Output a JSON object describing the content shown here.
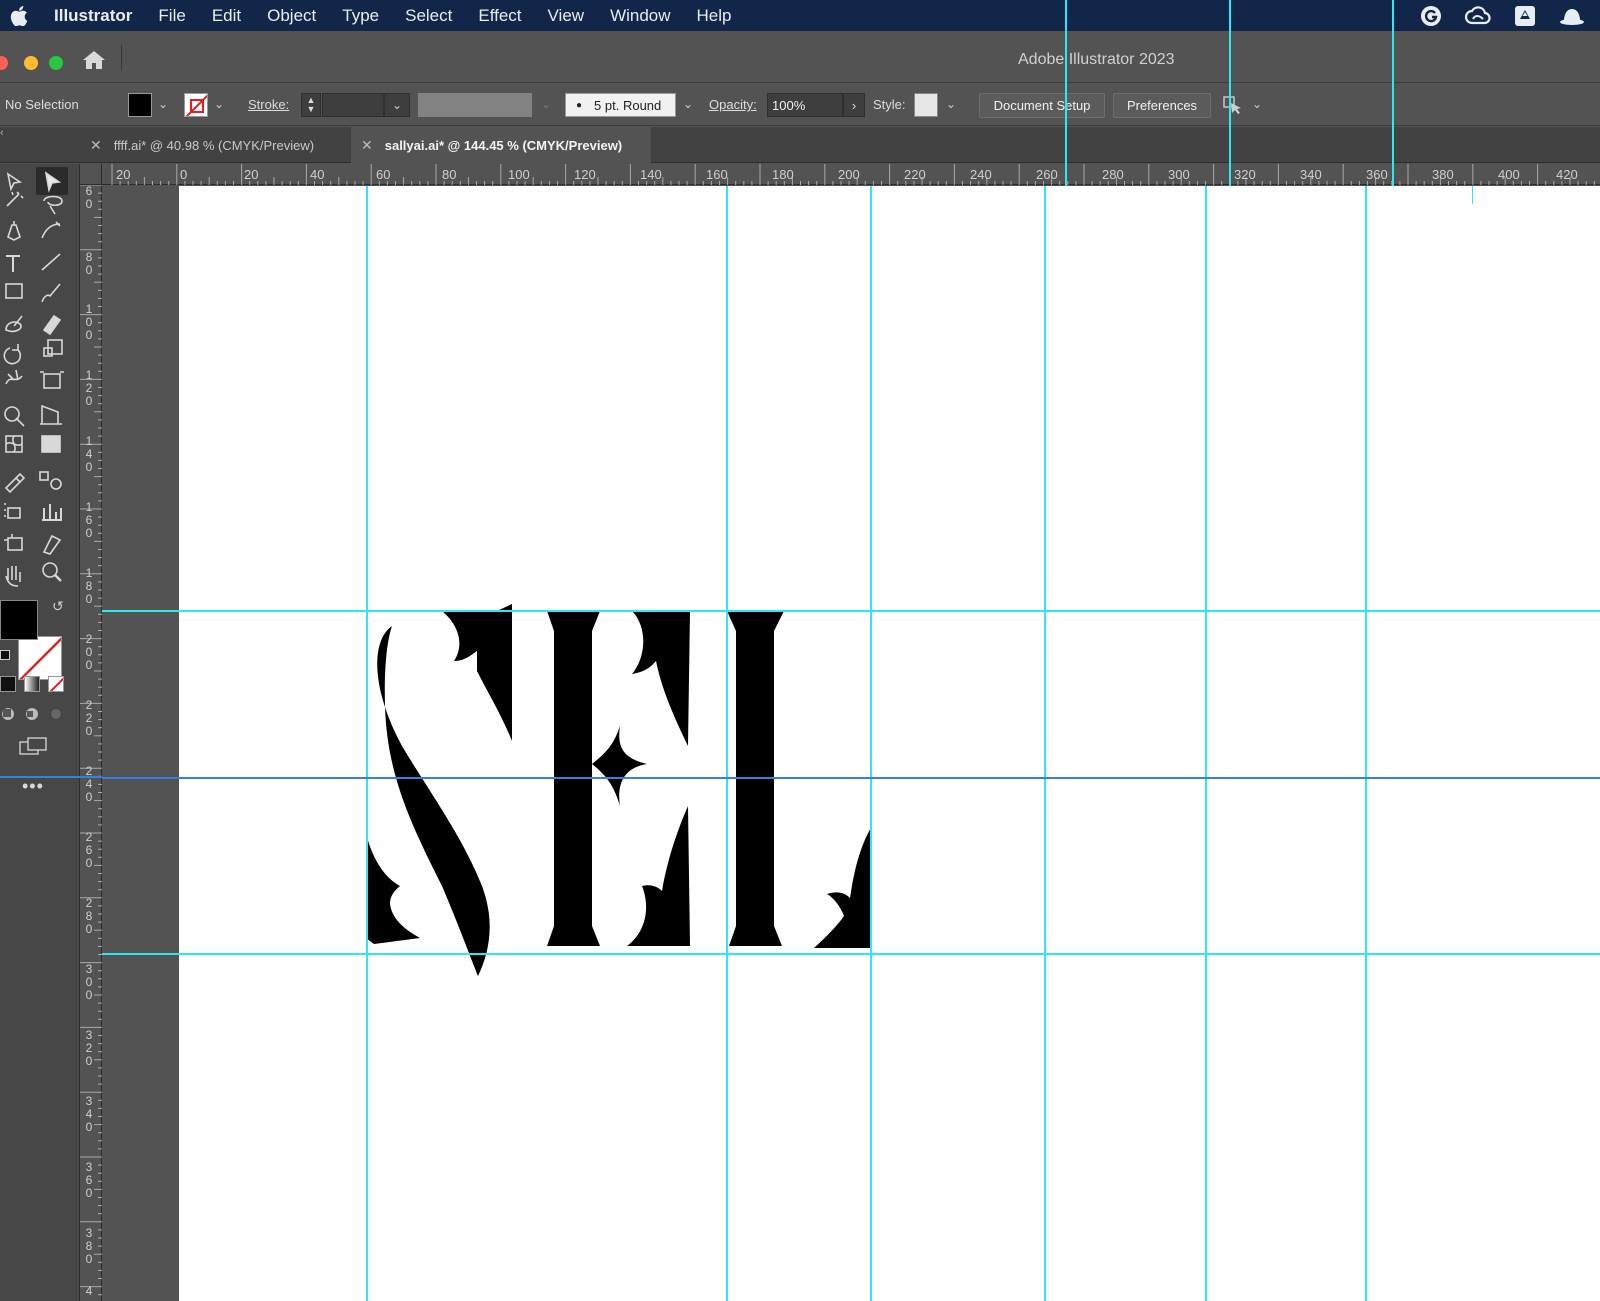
{
  "menubar": {
    "app_name": "Illustrator",
    "items": [
      "File",
      "Edit",
      "Object",
      "Type",
      "Select",
      "Effect",
      "View",
      "Window",
      "Help"
    ]
  },
  "window": {
    "title": "Adobe Illustrator 2023"
  },
  "controlbar": {
    "selection_label": "No Selection",
    "stroke_label": "Stroke:",
    "brush_value": "5 pt. Round",
    "opacity_label": "Opacity:",
    "opacity_value": "100%",
    "style_label": "Style:",
    "document_setup_label": "Document Setup",
    "preferences_label": "Preferences"
  },
  "tabs": [
    {
      "label": "ffff.ai* @ 40.98 % (CMYK/Preview)",
      "active": false
    },
    {
      "label": "sallyai.ai* @ 144.45 % (CMYK/Preview)",
      "active": true
    }
  ],
  "ruler_top": [
    "20",
    "0",
    "20",
    "40",
    "60",
    "80",
    "100",
    "120",
    "140",
    "160",
    "180",
    "200",
    "220",
    "240",
    "260",
    "280",
    "300",
    "320",
    "340",
    "360",
    "380",
    "400",
    "420"
  ],
  "ruler_left": [
    "60",
    "80",
    "100",
    "120",
    "140",
    "160",
    "180",
    "200",
    "220",
    "240",
    "260",
    "280",
    "300",
    "320",
    "340",
    "360",
    "380",
    "4"
  ],
  "colors": {
    "guide": "#32e6f0",
    "selection_guide": "#3c7ee0",
    "menubar": "#12264a",
    "artboard": "#ffffff",
    "ui_panel": "#535353"
  }
}
